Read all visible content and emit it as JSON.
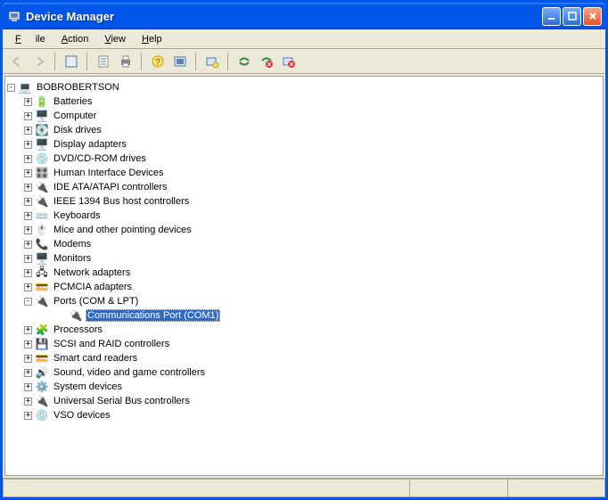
{
  "window": {
    "title": "Device Manager"
  },
  "menu": {
    "file": "File",
    "action": "Action",
    "view": "View",
    "help": "Help"
  },
  "tree": {
    "root": "BOBROBERTSON",
    "items": [
      {
        "label": "Batteries"
      },
      {
        "label": "Computer"
      },
      {
        "label": "Disk drives"
      },
      {
        "label": "Display adapters"
      },
      {
        "label": "DVD/CD-ROM drives"
      },
      {
        "label": "Human Interface Devices"
      },
      {
        "label": "IDE ATA/ATAPI controllers"
      },
      {
        "label": "IEEE 1394 Bus host controllers"
      },
      {
        "label": "Keyboards"
      },
      {
        "label": "Mice and other pointing devices"
      },
      {
        "label": "Modems"
      },
      {
        "label": "Monitors"
      },
      {
        "label": "Network adapters"
      },
      {
        "label": "PCMCIA adapters"
      },
      {
        "label": "Ports (COM & LPT)",
        "expanded": true,
        "children": [
          {
            "label": "Communications Port (COM1)",
            "selected": true
          }
        ]
      },
      {
        "label": "Processors"
      },
      {
        "label": "SCSI and RAID controllers"
      },
      {
        "label": "Smart card readers"
      },
      {
        "label": "Sound, video and game controllers"
      },
      {
        "label": "System devices"
      },
      {
        "label": "Universal Serial Bus controllers"
      },
      {
        "label": "VSO devices"
      }
    ]
  },
  "icons": {
    "root": "💻",
    "Batteries": "🔋",
    "Computer": "🖥️",
    "Disk drives": "💽",
    "Display adapters": "🖥️",
    "DVD/CD-ROM drives": "💿",
    "Human Interface Devices": "🎛️",
    "IDE ATA/ATAPI controllers": "🔌",
    "IEEE 1394 Bus host controllers": "🔌",
    "Keyboards": "⌨️",
    "Mice and other pointing devices": "🖱️",
    "Modems": "📞",
    "Monitors": "🖥️",
    "Network adapters": "🖧",
    "PCMCIA adapters": "💳",
    "Ports (COM & LPT)": "🔌",
    "Communications Port (COM1)": "🔌",
    "Processors": "🧩",
    "SCSI and RAID controllers": "💾",
    "Smart card readers": "💳",
    "Sound, video and game controllers": "🔊",
    "System devices": "⚙️",
    "Universal Serial Bus controllers": "🔌",
    "VSO devices": "💿"
  }
}
